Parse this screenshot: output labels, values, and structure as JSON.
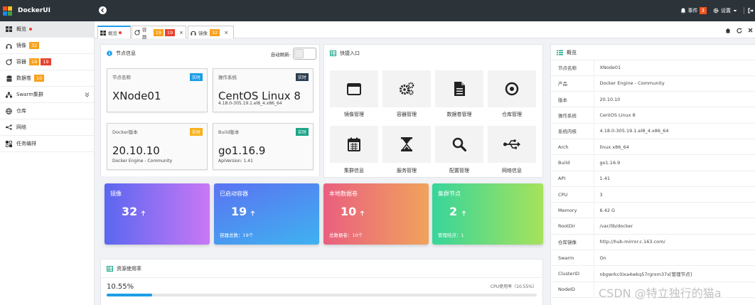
{
  "brand": {
    "name": "DockerUI"
  },
  "topbar": {
    "events_label": "事件",
    "events_count": "3",
    "settings_label": "设置"
  },
  "sidebar": {
    "items": [
      {
        "label": "概览",
        "icon": "dashboard-icon"
      },
      {
        "label": "镜像",
        "icon": "images-icon",
        "tag1": "32"
      },
      {
        "label": "容器",
        "icon": "containers-icon",
        "tag1": "19",
        "tag2": "19"
      },
      {
        "label": "数据卷",
        "icon": "volumes-icon",
        "tag1": "10"
      },
      {
        "label": "Swarm集群",
        "icon": "swarm-icon"
      },
      {
        "label": "仓库",
        "icon": "registry-icon"
      },
      {
        "label": "网络",
        "icon": "network-icon"
      },
      {
        "label": "任务编排",
        "icon": "tasks-icon"
      }
    ]
  },
  "tabs": [
    {
      "label": "概览"
    },
    {
      "label": "容器",
      "tag1": "19",
      "tag2": "19"
    },
    {
      "label": "镜像",
      "tag1": "32"
    }
  ],
  "node_info": {
    "title": "节点信息",
    "auto_refresh_label": "自动刷新:",
    "cards": [
      {
        "label": "节点名称",
        "badge": "实时",
        "value": "XNode01",
        "sub": ""
      },
      {
        "label": "操作系统",
        "badge": "实时",
        "value": "CentOS Linux 8",
        "sub": "4.18.0-305.19.1.el8_4.x86_64"
      },
      {
        "label": "Docker版本",
        "badge": "实时",
        "value": "20.10.10",
        "sub": "Docker Engine - Community"
      },
      {
        "label": "Build版本",
        "badge": "实时",
        "value": "go1.16.9",
        "sub": "ApiVersion: 1.41"
      }
    ]
  },
  "quick": {
    "title": "快捷入口",
    "items": [
      {
        "label": "镜像管理",
        "icon": "window-icon"
      },
      {
        "label": "容器管理",
        "icon": "gears-icon"
      },
      {
        "label": "数据卷管理",
        "icon": "document-icon"
      },
      {
        "label": "仓库管理",
        "icon": "target-icon"
      },
      {
        "label": "集群信息",
        "icon": "calendar-icon"
      },
      {
        "label": "服务管理",
        "icon": "hourglass-icon"
      },
      {
        "label": "配置管理",
        "icon": "magnifier-icon"
      },
      {
        "label": "网络信息",
        "icon": "usb-icon"
      }
    ]
  },
  "stats": [
    {
      "title": "镜像",
      "value": "32",
      "footer": "",
      "colors": [
        "#5a67f0",
        "#c978f5"
      ]
    },
    {
      "title": "已启动容器",
      "value": "19",
      "footer": "容器总数：19个",
      "colors": [
        "#5a73f2",
        "#3fb2f0"
      ]
    },
    {
      "title": "本地数据卷",
      "value": "10",
      "footer": "总数据卷：10个",
      "colors": [
        "#ea5f7f",
        "#f0a35c"
      ]
    },
    {
      "title": "集群节点",
      "value": "2",
      "footer": "管理结点：1",
      "colors": [
        "#37d59a",
        "#a7e25c"
      ]
    }
  ],
  "resources": {
    "title": "资源使用率",
    "cpu_percent": "10.55%",
    "cpu_label": "CPU使用率（10.55%）",
    "cpu_fraction": 0.1055
  },
  "overview": {
    "title": "概览",
    "rows": [
      {
        "k": "节点名称",
        "v": "XNode01"
      },
      {
        "k": "产品",
        "v": "Docker Engine - Community"
      },
      {
        "k": "版本",
        "v": "20.10.10"
      },
      {
        "k": "操作系统",
        "v": "CentOS Linux 8"
      },
      {
        "k": "系统内核",
        "v": "4.18.0-305.19.1.el8_4.x86_64"
      },
      {
        "k": "Arch",
        "v": "linux x86_64"
      },
      {
        "k": "Build",
        "v": "go1.16.9"
      },
      {
        "k": "API",
        "v": "1.41"
      },
      {
        "k": "CPU",
        "v": "3"
      },
      {
        "k": "Memory",
        "v": "6.42 G"
      },
      {
        "k": "RootDir",
        "v": "/var/lib/docker"
      },
      {
        "k": "仓库镜像",
        "v": "http://hub-mirror.c.163.com/"
      },
      {
        "k": "Swarm",
        "v": "On"
      },
      {
        "k": "ClusterID",
        "v": "nbgwrkc0ixa4wkq57rgrxm37x[管理节点]"
      },
      {
        "k": "NodeID",
        "v": ""
      }
    ]
  },
  "watermark": "CSDN @特立独行的猫a"
}
